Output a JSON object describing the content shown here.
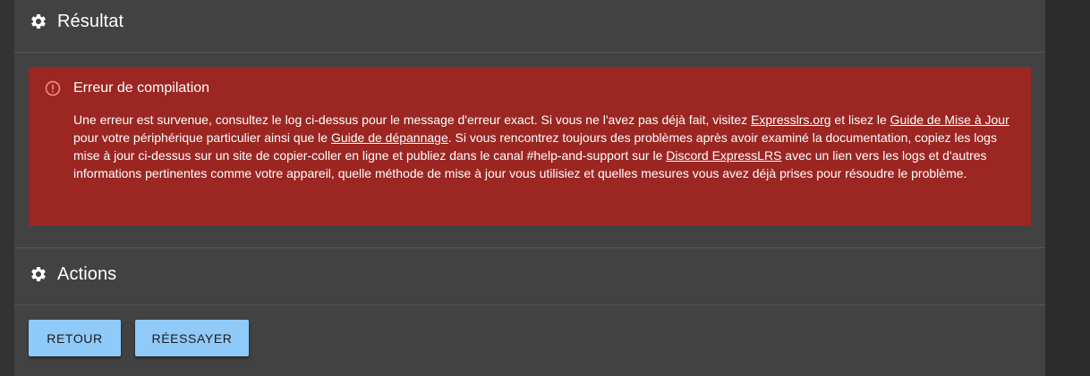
{
  "result_section": {
    "title": "Résultat",
    "icon": "gear-icon"
  },
  "error_alert": {
    "title": "Erreur de compilation",
    "icon": "error-circle-icon",
    "color": "#9b2622",
    "body": {
      "t1": "Une erreur est survenue, consultez le log ci-dessus pour le message d'erreur exact. Si vous ne l'avez pas déjà fait, visitez ",
      "link_expresslrs": "Expresslrs.org",
      "t2": " et lisez le ",
      "link_guide_update": "Guide de Mise à Jour",
      "t3": " pour votre périphérique particulier ainsi que le ",
      "link_troubleshooting": "Guide de dépannage",
      "t4": ". Si vous rencontrez toujours des problèmes après avoir examiné la documentation, copiez les logs mise à jour ci-dessus sur un site de copier-coller en ligne et publiez dans le canal #help-and-support sur le ",
      "link_discord": "Discord ExpressLRS",
      "t5": " avec un lien vers les logs et d'autres informations pertinentes comme votre appareil, quelle méthode de mise à jour vous utilisiez et quelles mesures vous avez déjà prises pour résoudre le problème."
    }
  },
  "actions_section": {
    "title": "Actions",
    "icon": "gear-icon",
    "buttons": {
      "back": "RETOUR",
      "retry": "RÉESSAYER"
    },
    "button_color": "#90caf9"
  }
}
